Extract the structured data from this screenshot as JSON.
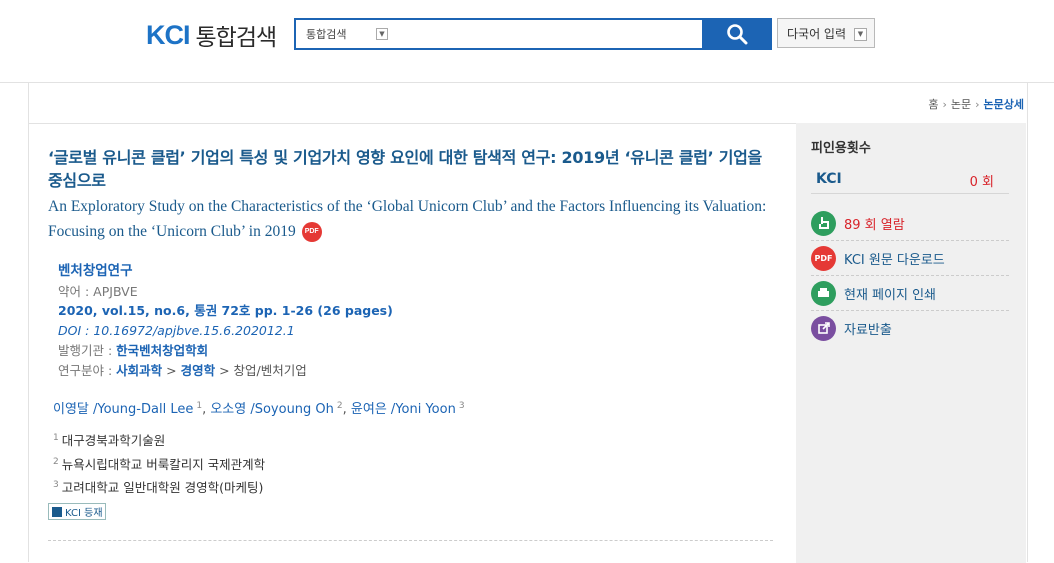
{
  "header": {
    "logo_kci": "KCI",
    "logo_service": "통합검색",
    "search_scope": "통합검색",
    "multilang_label": "다국어 입력"
  },
  "breadcrumb": {
    "home": "홈",
    "section": "논문",
    "current": "논문상세"
  },
  "article": {
    "title_ko": "‘글로벌 유니콘 클럽’ 기업의 특성 및 기업가치 영향 요인에 대한 탐색적 연구: 2019년 ‘유니콘 클럽’ 기업을 중심으로",
    "title_en": "An Exploratory Study on the Characteristics of the ‘Global Unicorn Club’ and the Factors Influencing its Valuation: Focusing on the ‘Unicorn Club’ in 2019",
    "pdf_badge": "PDF",
    "journal": "벤처창업연구",
    "abbr_label": "약어 : ",
    "abbr": "APJBVE",
    "volume_info": "2020, vol.15, no.6, 통권 72호 pp. 1-26 (26 pages)",
    "doi_label": "DOI : ",
    "doi": "10.16972/apjbve.15.6.202012.1",
    "publisher_label": "발행기관 : ",
    "publisher": "한국벤처창업학회",
    "field_label": "연구분야 : ",
    "field_1": "사회과학",
    "field_2": "경영학",
    "field_3": "창업/벤처기업",
    "field_sep": " > ",
    "authors": [
      {
        "name": "이영달 /Young-Dall Lee",
        "sup": "1"
      },
      {
        "name": "오소영 /Soyoung Oh",
        "sup": "2"
      },
      {
        "name": "윤여은 /Yoni Yoon",
        "sup": "3"
      }
    ],
    "affiliations": [
      {
        "sup": "1",
        "name": "대구경북과학기술원"
      },
      {
        "sup": "2",
        "name": "뉴욕시립대학교 버룩칼리지 국제관계학"
      },
      {
        "sup": "3",
        "name": "고려대학교 일반대학원 경영학(마케팅)"
      }
    ],
    "kci_tag": "KCI 등재"
  },
  "sidebar": {
    "citation_title": "피인용횟수",
    "citation_label": "KCI",
    "citation_value": "0 회",
    "views": "89 회 열람",
    "download": "KCI 원문 다운로드",
    "print": "현재 페이지 인쇄",
    "export": "자료반출"
  },
  "colors": {
    "brand_blue": "#1c64b4",
    "title_blue": "#1a5a8c",
    "alert_red": "#d8232a",
    "views_green": "#2e9e5e",
    "pdf_red": "#e53935",
    "export_purple": "#7a4ea0"
  }
}
